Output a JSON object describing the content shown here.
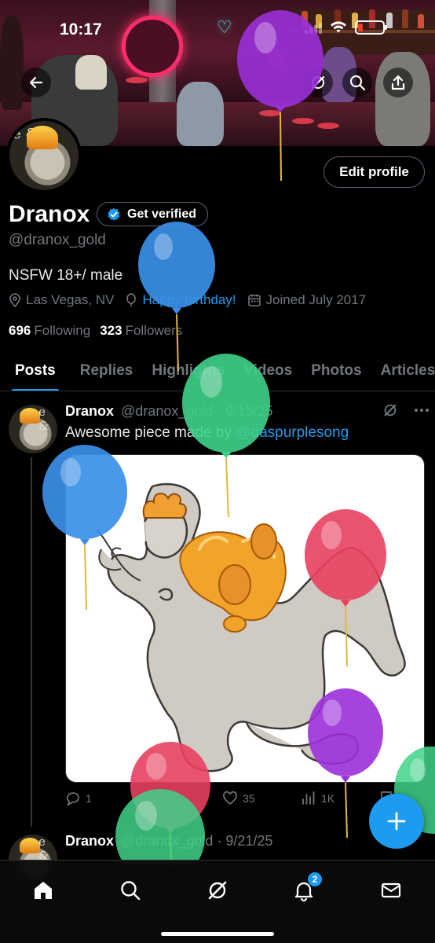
{
  "status_bar": {
    "time": "10:17"
  },
  "profile": {
    "display_name": "Dranox",
    "verify_label": "Get verified",
    "handle": "@dranox_gold",
    "bio": "NSFW 18+/ male",
    "location": "Las Vegas, NV",
    "birthday": "Happy birthday!",
    "joined": "Joined July 2017",
    "following_count": "696",
    "following_label": "Following",
    "followers_count": "323",
    "followers_label": "Followers",
    "edit_label": "Edit profile",
    "avatar_text": "e &"
  },
  "tabs": [
    {
      "label": "Posts",
      "active": true
    },
    {
      "label": "Replies",
      "active": false
    },
    {
      "label": "Highlights",
      "active": false
    },
    {
      "label": "Videos",
      "active": false
    },
    {
      "label": "Photos",
      "active": false
    },
    {
      "label": "Articles",
      "active": false
    }
  ],
  "post": {
    "author": "Dranox",
    "handle": "@dranox_gold",
    "date": "9/15/25",
    "text": "Awesome piece made by ",
    "mention": "@daspurplesong",
    "replies": "1",
    "likes": "35",
    "views": "1K"
  },
  "post2": {
    "author": "Dranox",
    "handle": "@dranox_gold",
    "date": "9/21/25"
  },
  "nav": {
    "notifications_badge": "2"
  },
  "colors": {
    "accent": "#1d9bf0",
    "background": "#000000",
    "muted_text": "#71767b",
    "balloon_purple": "#9b30d9",
    "balloon_blue": "#3b8fe8",
    "balloon_green": "#3fd28a",
    "balloon_red": "#e8405f"
  }
}
